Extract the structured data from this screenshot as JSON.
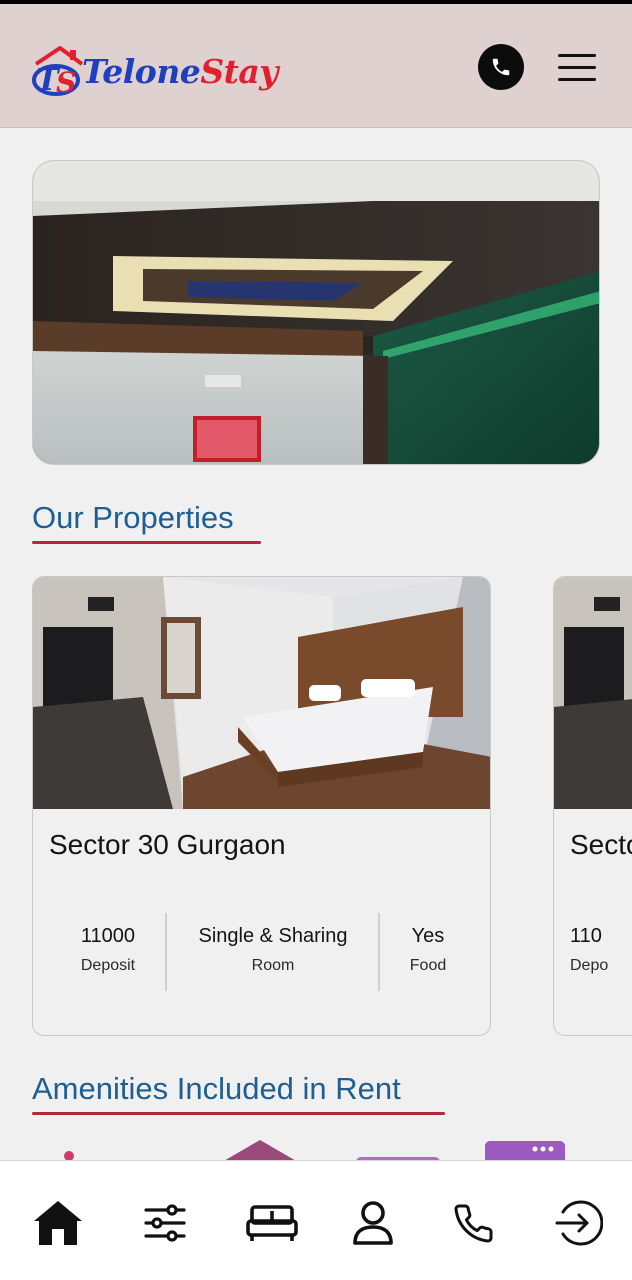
{
  "header": {
    "logo_initials": "TS",
    "logo_part1": "Telone",
    "logo_part2": "Stay",
    "icons": [
      "phone-icon",
      "hamburger-menu-icon"
    ]
  },
  "sections": {
    "properties_title": "Our Properties",
    "amenities_title": "Amenities Included in Rent"
  },
  "properties": [
    {
      "name": "Sector 30 Gurgaon",
      "stats": [
        {
          "value": "11000",
          "label": "Deposit"
        },
        {
          "value": "Single & Sharing",
          "label": "Room"
        },
        {
          "value": "Yes",
          "label": "Food"
        }
      ]
    },
    {
      "name": "Secto",
      "stats": [
        {
          "value": "110",
          "label": "Depo"
        }
      ]
    }
  ],
  "bottom_nav": [
    "home-icon",
    "filters-icon",
    "bed-icon",
    "profile-icon",
    "phone-icon",
    "login-icon"
  ],
  "colors": {
    "header_bg": "#e0d1d1",
    "title_blue": "#1d5f92",
    "underline_red": "#b0283a",
    "logo_blue": "#1d3fc0",
    "logo_red": "#e0202e"
  }
}
